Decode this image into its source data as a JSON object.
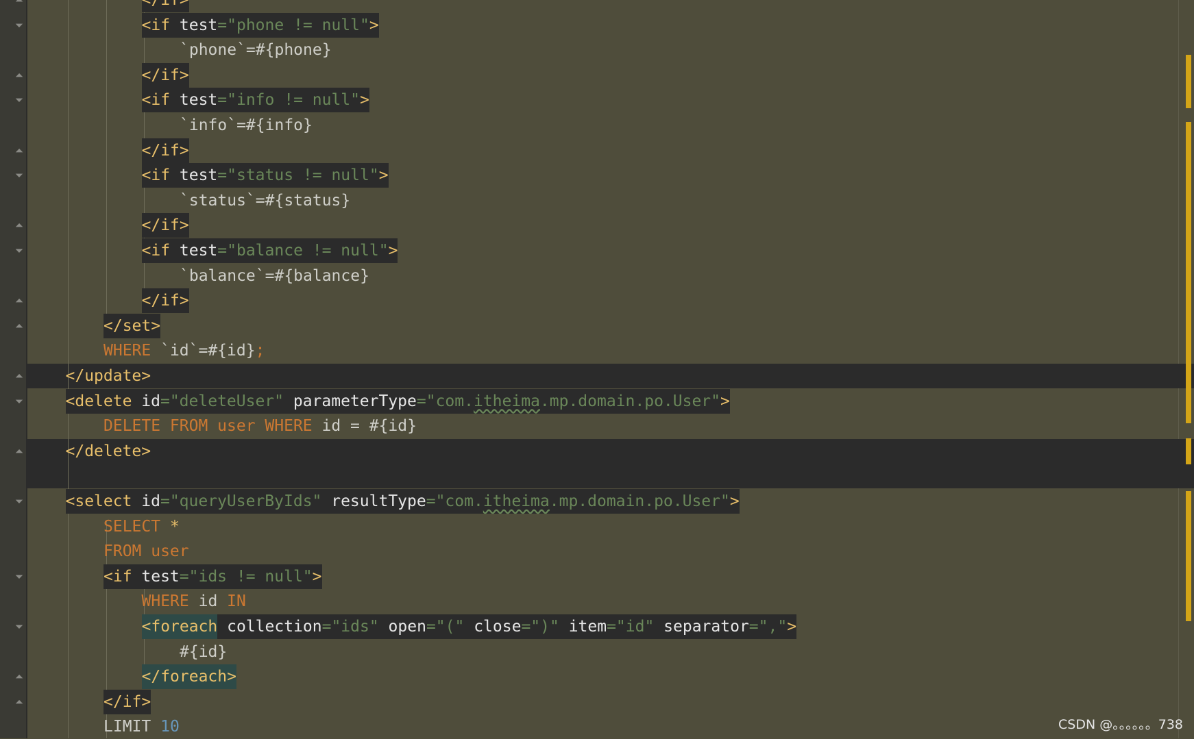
{
  "editor": {
    "language": "xml-mybatis-mapper",
    "colors": {
      "background": "#4f4d3b",
      "tag": "#e8bf6a",
      "string": "#6a8759",
      "keyword": "#cc7832",
      "number": "#6897bb",
      "highlight": "#2b2b2b"
    },
    "lines": [
      {
        "indent": 3,
        "parts": [
          {
            "t": "</if>",
            "c": "tag"
          }
        ],
        "hl": true
      },
      {
        "indent": 3,
        "parts": [
          {
            "t": "<if ",
            "c": "tag"
          },
          {
            "t": "test",
            "c": "attr"
          },
          {
            "t": "=\"",
            "c": "str"
          },
          {
            "t": "phone != null",
            "c": "str"
          },
          {
            "t": "\"",
            "c": "str"
          },
          {
            "t": ">",
            "c": "tag"
          }
        ],
        "hl": true
      },
      {
        "indent": 4,
        "parts": [
          {
            "t": "`phone`=#{phone}",
            "c": "plain"
          }
        ]
      },
      {
        "indent": 3,
        "parts": [
          {
            "t": "</if>",
            "c": "tag"
          }
        ],
        "hl": true
      },
      {
        "indent": 3,
        "parts": [
          {
            "t": "<if ",
            "c": "tag"
          },
          {
            "t": "test",
            "c": "attr"
          },
          {
            "t": "=\"",
            "c": "str"
          },
          {
            "t": "info != null",
            "c": "str"
          },
          {
            "t": "\"",
            "c": "str"
          },
          {
            "t": ">",
            "c": "tag"
          }
        ],
        "hl": true
      },
      {
        "indent": 4,
        "parts": [
          {
            "t": "`info`=#{info}",
            "c": "plain"
          }
        ]
      },
      {
        "indent": 3,
        "parts": [
          {
            "t": "</if>",
            "c": "tag"
          }
        ],
        "hl": true
      },
      {
        "indent": 3,
        "parts": [
          {
            "t": "<if ",
            "c": "tag"
          },
          {
            "t": "test",
            "c": "attr"
          },
          {
            "t": "=\"",
            "c": "str"
          },
          {
            "t": "status != null",
            "c": "str"
          },
          {
            "t": "\"",
            "c": "str"
          },
          {
            "t": ">",
            "c": "tag"
          }
        ],
        "hl": true
      },
      {
        "indent": 4,
        "parts": [
          {
            "t": "`status`=#{status}",
            "c": "plain"
          }
        ]
      },
      {
        "indent": 3,
        "parts": [
          {
            "t": "</if>",
            "c": "tag"
          }
        ],
        "hl": true
      },
      {
        "indent": 3,
        "parts": [
          {
            "t": "<if ",
            "c": "tag"
          },
          {
            "t": "test",
            "c": "attr"
          },
          {
            "t": "=\"",
            "c": "str"
          },
          {
            "t": "balance != null",
            "c": "str"
          },
          {
            "t": "\"",
            "c": "str"
          },
          {
            "t": ">",
            "c": "tag"
          }
        ],
        "hl": true
      },
      {
        "indent": 4,
        "parts": [
          {
            "t": "`balance`=#{balance}",
            "c": "plain"
          }
        ]
      },
      {
        "indent": 3,
        "parts": [
          {
            "t": "</if>",
            "c": "tag"
          }
        ],
        "hl": true
      },
      {
        "indent": 2,
        "parts": [
          {
            "t": "</set>",
            "c": "tag"
          }
        ],
        "hl": true
      },
      {
        "indent": 2,
        "parts": [
          {
            "t": "WHERE ",
            "c": "kw"
          },
          {
            "t": "`id`=#{id}",
            "c": "plain"
          },
          {
            "t": ";",
            "c": "kw"
          }
        ]
      },
      {
        "indent": 1,
        "parts": [
          {
            "t": "</update>",
            "c": "tag"
          }
        ],
        "row": true
      },
      {
        "indent": 1,
        "parts": [
          {
            "t": "<delete ",
            "c": "tag"
          },
          {
            "t": "id",
            "c": "attr"
          },
          {
            "t": "=\"deleteUser\" ",
            "c": "str"
          },
          {
            "t": "parameterType",
            "c": "attr"
          },
          {
            "t": "=\"com.",
            "c": "str"
          },
          {
            "t": "itheima",
            "c": "str",
            "sq": true
          },
          {
            "t": ".mp.domain.po.User\"",
            "c": "str"
          },
          {
            "t": ">",
            "c": "tag"
          }
        ],
        "hl": true
      },
      {
        "indent": 2,
        "parts": [
          {
            "t": "DELETE FROM user WHERE ",
            "c": "kw"
          },
          {
            "t": "id = #{id}",
            "c": "plain"
          }
        ]
      },
      {
        "indent": 1,
        "parts": [
          {
            "t": "</delete>",
            "c": "tag"
          }
        ],
        "row": true
      },
      {
        "indent": 0,
        "parts": [],
        "row": true
      },
      {
        "indent": 1,
        "parts": [
          {
            "t": "<select ",
            "c": "tag"
          },
          {
            "t": "id",
            "c": "attr"
          },
          {
            "t": "=\"queryUserByIds\" ",
            "c": "str"
          },
          {
            "t": "resultType",
            "c": "attr"
          },
          {
            "t": "=\"com.",
            "c": "str"
          },
          {
            "t": "itheima",
            "c": "str",
            "sq": true
          },
          {
            "t": ".mp.domain.po.User\"",
            "c": "str"
          },
          {
            "t": ">",
            "c": "tag"
          }
        ],
        "hl": true
      },
      {
        "indent": 2,
        "parts": [
          {
            "t": "SELECT ",
            "c": "kw"
          },
          {
            "t": "*",
            "c": "tag"
          }
        ]
      },
      {
        "indent": 2,
        "parts": [
          {
            "t": "FROM user",
            "c": "kw"
          }
        ]
      },
      {
        "indent": 2,
        "parts": [
          {
            "t": "<if ",
            "c": "tag"
          },
          {
            "t": "test",
            "c": "attr"
          },
          {
            "t": "=\"ids != null\"",
            "c": "str"
          },
          {
            "t": ">",
            "c": "tag"
          }
        ],
        "hl": true
      },
      {
        "indent": 3,
        "parts": [
          {
            "t": "WHERE ",
            "c": "kw"
          },
          {
            "t": "id ",
            "c": "plain"
          },
          {
            "t": "IN",
            "c": "kw"
          }
        ]
      },
      {
        "indent": 3,
        "parts": [
          {
            "t": "<foreach",
            "c": "tag",
            "fe": true
          },
          {
            "t": " collection",
            "c": "attr",
            "hl": true
          },
          {
            "t": "=\"ids\" ",
            "c": "str",
            "hl": true
          },
          {
            "t": "open",
            "c": "attr",
            "hl": true
          },
          {
            "t": "=\"(\" ",
            "c": "str",
            "hl": true
          },
          {
            "t": "close",
            "c": "attr",
            "hl": true
          },
          {
            "t": "=\")\" ",
            "c": "str",
            "hl": true
          },
          {
            "t": "item",
            "c": "attr",
            "hl": true
          },
          {
            "t": "=\"id\" ",
            "c": "str",
            "hl": true
          },
          {
            "t": "separator",
            "c": "attr",
            "hl": true
          },
          {
            "t": "=\",\"",
            "c": "str",
            "hl": true
          },
          {
            "t": ">",
            "c": "tag",
            "hl": true
          }
        ]
      },
      {
        "indent": 4,
        "parts": [
          {
            "t": "#{id}",
            "c": "plain"
          }
        ]
      },
      {
        "indent": 3,
        "parts": [
          {
            "t": "</foreach>",
            "c": "tag",
            "fe": true
          }
        ]
      },
      {
        "indent": 2,
        "parts": [
          {
            "t": "</if>",
            "c": "tag"
          }
        ],
        "hl": true
      },
      {
        "indent": 2,
        "parts": [
          {
            "t": "LIMIT ",
            "c": "plain"
          },
          {
            "t": "10",
            "c": "num"
          }
        ]
      }
    ]
  },
  "watermark": "CSDN @。。。。。。738"
}
